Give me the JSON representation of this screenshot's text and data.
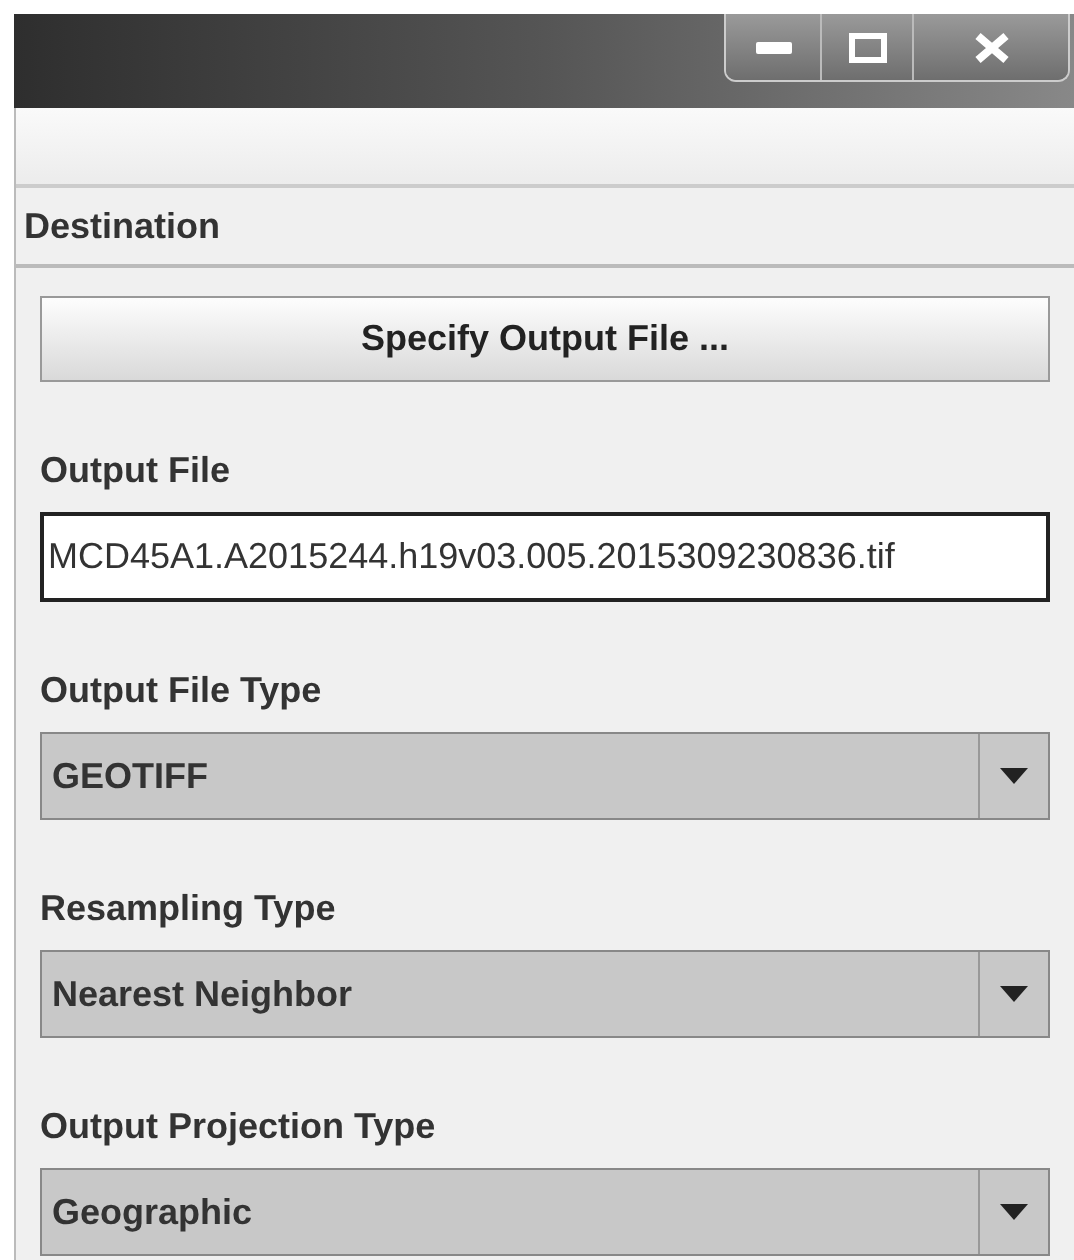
{
  "window": {
    "controls": [
      {
        "kind": "minimize"
      },
      {
        "kind": "maximize"
      },
      {
        "kind": "close"
      }
    ]
  },
  "section": {
    "title": "Destination"
  },
  "specify_button": {
    "label": "Specify Output File ..."
  },
  "fields": [
    {
      "kind": "text",
      "label": "Output File",
      "value": "MCD45A1.A2015244.h19v03.005.2015309230836.tif"
    },
    {
      "kind": "dropdown",
      "label": "Output File Type",
      "value": "GEOTIFF"
    },
    {
      "kind": "dropdown",
      "label": "Resampling Type",
      "value": "Nearest Neighbor"
    },
    {
      "kind": "dropdown",
      "label": "Output Projection Type",
      "value": "Geographic"
    }
  ]
}
